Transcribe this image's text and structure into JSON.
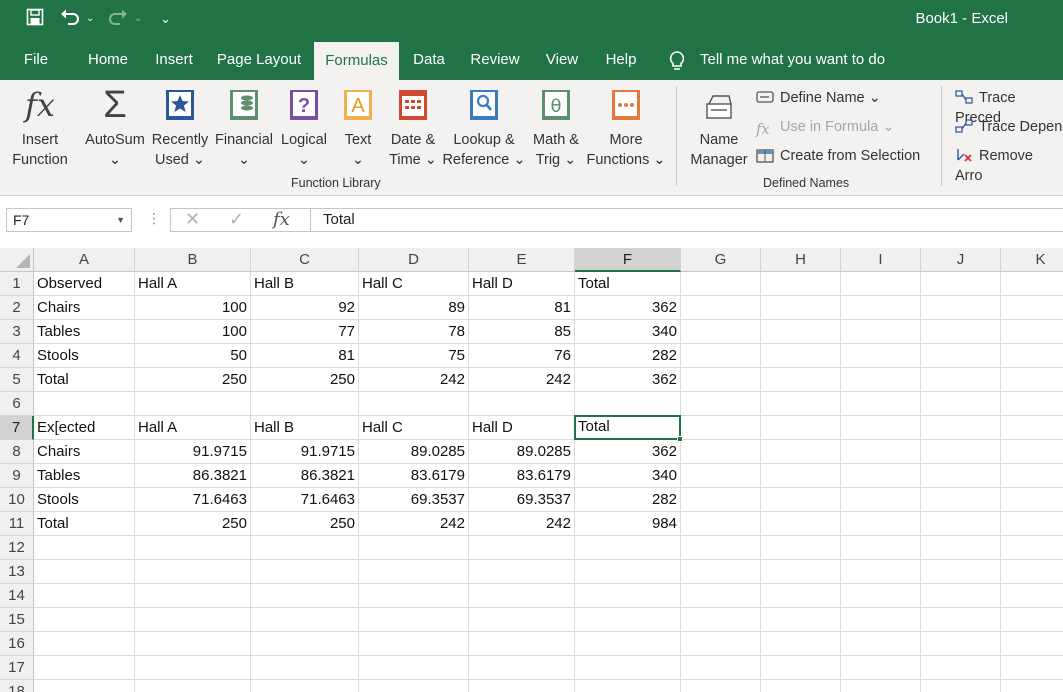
{
  "window": {
    "title": "Book1  -  Excel"
  },
  "tabs": [
    "File",
    "Home",
    "Insert",
    "Page Layout",
    "Formulas",
    "Data",
    "Review",
    "View",
    "Help"
  ],
  "active_tab": "Formulas",
  "tell_me": "Tell me what you want to do",
  "ribbon": {
    "insert_function": [
      "Insert",
      "Function"
    ],
    "autosum": [
      "AutoSum",
      "⌄"
    ],
    "recently_used": [
      "Recently",
      "Used ⌄"
    ],
    "financial": [
      "Financial",
      "⌄"
    ],
    "logical": [
      "Logical",
      "⌄"
    ],
    "text": [
      "Text",
      "⌄"
    ],
    "date_time": [
      "Date &",
      "Time ⌄"
    ],
    "lookup_reference": [
      "Lookup &",
      "Reference ⌄"
    ],
    "math_trig": [
      "Math &",
      "Trig ⌄"
    ],
    "more_functions": [
      "More",
      "Functions ⌄"
    ],
    "function_library_label": "Function Library",
    "name_manager": [
      "Name",
      "Manager"
    ],
    "define_name": "Define Name  ⌄",
    "use_in_formula": "Use in Formula ⌄",
    "create_from_selection": "Create from Selection",
    "defined_names_label": "Defined Names",
    "trace_precedents": "Trace Preced",
    "trace_dependents": "Trace Depen",
    "remove_arrows": "Remove Arro"
  },
  "formula_bar": {
    "name_box": "F7",
    "content": "Total"
  },
  "columns": [
    "A",
    "B",
    "C",
    "D",
    "E",
    "F",
    "G",
    "H",
    "I",
    "J",
    "K"
  ],
  "selected_cell": "F7",
  "rows": [
    [
      "Observed",
      "Hall A",
      "Hall B",
      "Hall C",
      "Hall D",
      "Total"
    ],
    [
      "Chairs",
      "100",
      "92",
      "89",
      "81",
      "362"
    ],
    [
      "Tables",
      "100",
      "77",
      "78",
      "85",
      "340"
    ],
    [
      "Stools",
      "50",
      "81",
      "75",
      "76",
      "282"
    ],
    [
      "Total",
      "250",
      "250",
      "242",
      "242",
      "362"
    ],
    [
      "",
      "",
      "",
      "",
      "",
      ""
    ],
    [
      "Ex[ected",
      "Hall A",
      "Hall B",
      "Hall C",
      "Hall D",
      "Total"
    ],
    [
      "Chairs",
      "91.9715",
      "91.9715",
      "89.0285",
      "89.0285",
      "362"
    ],
    [
      "Tables",
      "86.3821",
      "86.3821",
      "83.6179",
      "83.6179",
      "340"
    ],
    [
      "Stools",
      "71.6463",
      "71.6463",
      "69.3537",
      "69.3537",
      "282"
    ],
    [
      "Total",
      "250",
      "250",
      "242",
      "242",
      "984"
    ],
    [
      "",
      "",
      "",
      "",
      "",
      ""
    ],
    [
      "",
      "",
      "",
      "",
      "",
      ""
    ],
    [
      "",
      "",
      "",
      "",
      "",
      ""
    ],
    [
      "",
      "",
      "",
      "",
      "",
      ""
    ],
    [
      "",
      "",
      "",
      "",
      "",
      ""
    ],
    [
      "",
      "",
      "",
      "",
      "",
      ""
    ],
    [
      "",
      "",
      "",
      "",
      "",
      ""
    ]
  ],
  "row_numbers": [
    "1",
    "2",
    "3",
    "4",
    "5",
    "6",
    "7",
    "8",
    "9",
    "10",
    "11",
    "12",
    "13",
    "14",
    "15",
    "16",
    "17",
    "18"
  ],
  "colors": {
    "accent": "#217346",
    "ribbon_bg": "#f3f2f1"
  }
}
